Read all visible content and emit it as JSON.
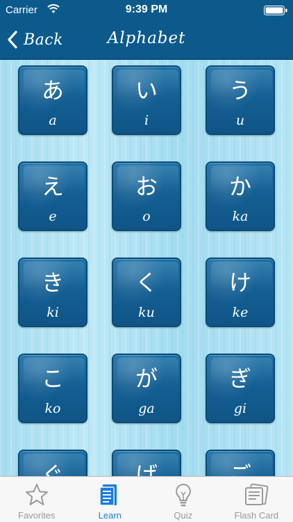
{
  "status_bar": {
    "carrier": "Carrier",
    "time": "9:39 PM"
  },
  "nav": {
    "back_label": "Back",
    "title": "Alphabet"
  },
  "tiles": [
    {
      "kana": "あ",
      "romaji": "a"
    },
    {
      "kana": "い",
      "romaji": "i"
    },
    {
      "kana": "う",
      "romaji": "u"
    },
    {
      "kana": "え",
      "romaji": "e"
    },
    {
      "kana": "お",
      "romaji": "o"
    },
    {
      "kana": "か",
      "romaji": "ka"
    },
    {
      "kana": "き",
      "romaji": "ki"
    },
    {
      "kana": "く",
      "romaji": "ku"
    },
    {
      "kana": "け",
      "romaji": "ke"
    },
    {
      "kana": "こ",
      "romaji": "ko"
    },
    {
      "kana": "が",
      "romaji": "ga"
    },
    {
      "kana": "ぎ",
      "romaji": "gi"
    },
    {
      "kana": "ぐ",
      "romaji": ""
    },
    {
      "kana": "げ",
      "romaji": ""
    },
    {
      "kana": "ご",
      "romaji": ""
    }
  ],
  "tabs": [
    {
      "label": "Favorites",
      "icon": "star-icon",
      "active": false
    },
    {
      "label": "Learn",
      "icon": "document-icon",
      "active": true
    },
    {
      "label": "Quiz",
      "icon": "lightbulb-icon",
      "active": false
    },
    {
      "label": "Flash Card",
      "icon": "flashcard-icon",
      "active": false
    }
  ],
  "colors": {
    "header": "#0c5a8c",
    "tile": "#145f93",
    "active_tab": "#1a7de0"
  }
}
